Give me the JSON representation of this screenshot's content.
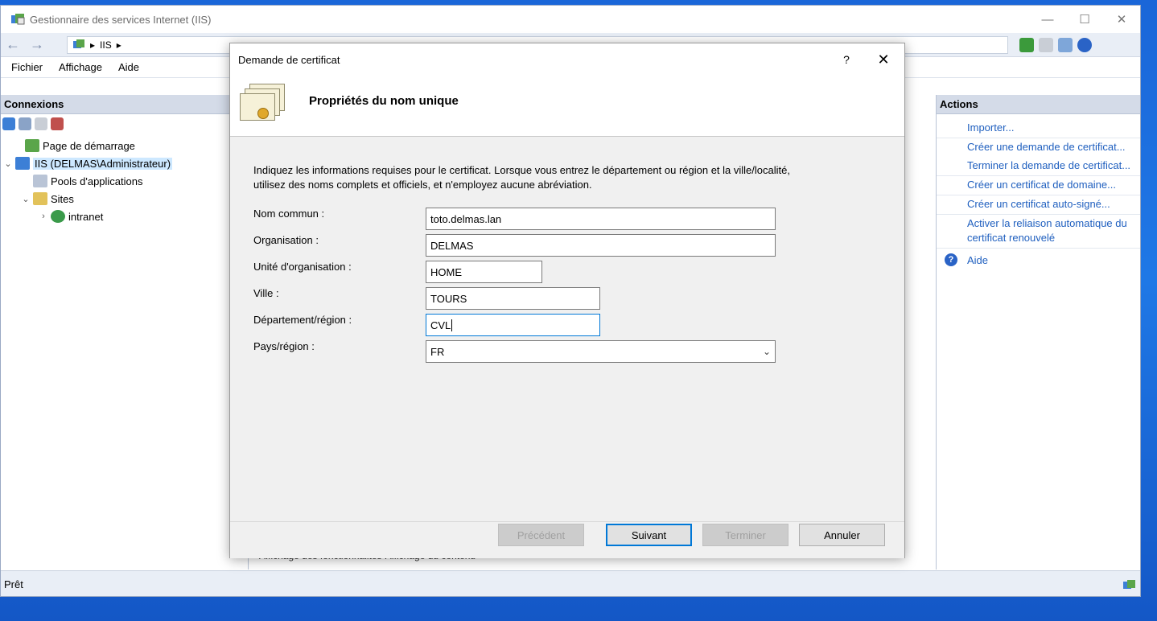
{
  "window": {
    "title": "Gestionnaire des services Internet (IIS)",
    "controls": {
      "minimize": "—",
      "maximize": "☐",
      "close": "✕"
    }
  },
  "addressbar": {
    "back": "←",
    "forward": "→",
    "path_arrow1": "▸",
    "path_item": "IIS",
    "path_arrow2": "▸"
  },
  "menu": {
    "file": "Fichier",
    "view": "Affichage",
    "help": "Aide"
  },
  "connections": {
    "header": "Connexions",
    "tree": [
      {
        "label": "Page de démarrage"
      },
      {
        "label": "IIS (DELMAS\\Administrateur)"
      },
      {
        "label": "Pools d'applications"
      },
      {
        "label": "Sites"
      },
      {
        "label": "intranet"
      }
    ]
  },
  "center": {
    "tab_features": "Affichage des fonctionnalités",
    "tab_content": "Affichage du contenu"
  },
  "actions": {
    "header": "Actions",
    "links": [
      "Importer...",
      "Créer une demande de certificat...",
      "Terminer la demande de certificat...",
      "Créer un certificat de domaine...",
      "Créer un certificat auto-signé...",
      "Activer la reliaison automatique du certificat renouvelé"
    ],
    "help": "Aide"
  },
  "status": {
    "text": "Prêt"
  },
  "dialog": {
    "title": "Demande de certificat",
    "help_glyph": "?",
    "close_glyph": "✕",
    "heading": "Propriétés du nom unique",
    "instructions": "Indiquez les informations requises pour le certificat. Lorsque vous entrez le département ou région et la ville/localité, utilisez des noms complets et officiels, et n'employez aucune abréviation.",
    "fields": {
      "common_name": {
        "label": "Nom commun :",
        "value": "toto.delmas.lan"
      },
      "organization": {
        "label": "Organisation :",
        "value": "DELMAS"
      },
      "org_unit": {
        "label": "Unité d'organisation :",
        "value": "HOME"
      },
      "city": {
        "label": "Ville :",
        "value": "TOURS"
      },
      "state": {
        "label": "Département/région :",
        "value": "CVL"
      },
      "country": {
        "label": "Pays/région :",
        "value": "FR"
      }
    },
    "buttons": {
      "previous": "Précédent",
      "next": "Suivant",
      "finish": "Terminer",
      "cancel": "Annuler"
    }
  },
  "colors": {
    "accent": "#0078d7",
    "link": "#1f5fbf",
    "pane_header": "#d4dbe8",
    "desktop": "#1f78e6"
  }
}
